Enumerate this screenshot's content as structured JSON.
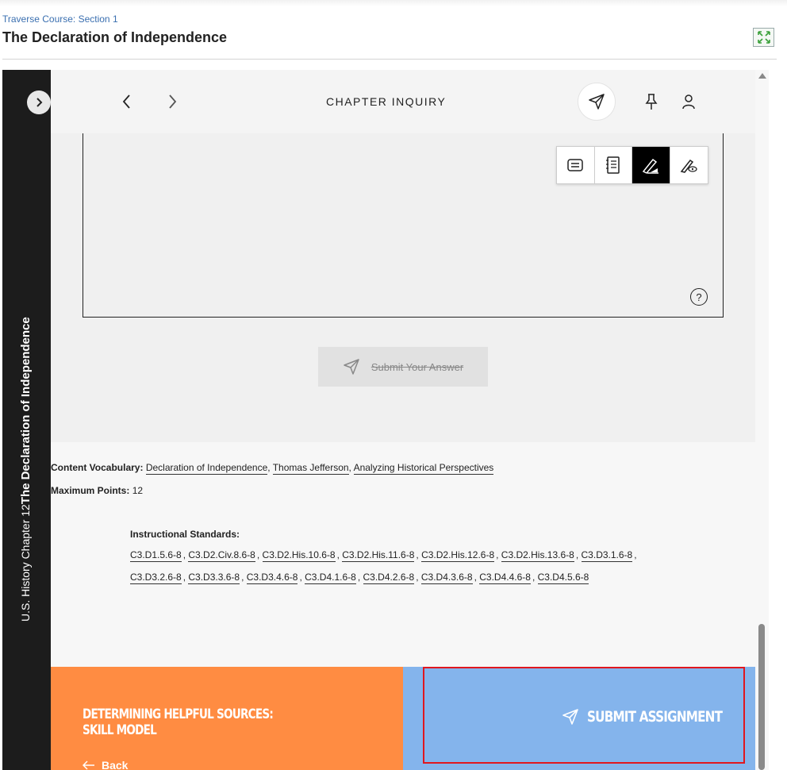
{
  "header": {
    "breadcrumb": "Traverse Course: Section 1",
    "title": "The Declaration of Independence"
  },
  "sidebar": {
    "chapter": "U.S. History Chapter 12",
    "lesson": "The Declaration of Independence"
  },
  "nav": {
    "title": "CHAPTER INQUIRY"
  },
  "answer": {
    "submit_label": "Submit Your Answer",
    "help_glyph": "?"
  },
  "content": {
    "vocab_label": "Content Vocabulary:",
    "vocab": [
      "Declaration of Independence",
      "Thomas Jefferson",
      "Analyzing Historical Perspectives"
    ],
    "points_label": "Maximum Points:",
    "points": "12",
    "standards_label": "Instructional Standards:",
    "standards_row1": [
      "C3.D1.5.6-8",
      "C3.D2.Civ.8.6-8",
      "C3.D2.His.10.6-8",
      "C3.D2.His.11.6-8",
      "C3.D2.His.12.6-8",
      "C3.D2.His.13.6-8",
      "C3.D3.1.6-8"
    ],
    "standards_row2": [
      "C3.D3.2.6-8",
      "C3.D3.3.6-8",
      "C3.D3.4.6-8",
      "C3.D4.1.6-8",
      "C3.D4.2.6-8",
      "C3.D4.3.6-8",
      "C3.D4.4.6-8",
      "C3.D4.5.6-8"
    ]
  },
  "footer": {
    "prev_title": "DETERMINING HELPFUL SOURCES: SKILL MODEL",
    "back_label": "Back",
    "submit_assignment": "SUBMIT ASSIGNMENT"
  },
  "colors": {
    "orange": "#ff8c42",
    "blue": "#84b4ec",
    "highlight": "#e0171f",
    "sidebar": "#1c1c1c"
  }
}
